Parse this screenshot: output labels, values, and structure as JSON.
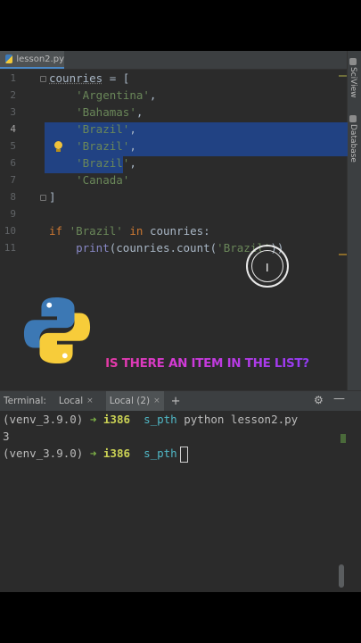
{
  "editor": {
    "tab_label": "lesson2.py",
    "line_numbers": [
      "1",
      "2",
      "3",
      "4",
      "5",
      "6",
      "7",
      "8",
      "9",
      "10",
      "11"
    ],
    "code": {
      "l1_var": "counries",
      "l1_rest": " = [",
      "l2": "'Argentina'",
      "l3": "'Bahamas'",
      "l4": "'Brazil'",
      "l5": "'Brazil'",
      "l6": "'Brazil'",
      "l7": "'Canada'",
      "l8": "]",
      "l10_kw1": "if",
      "l10_str": "'Brazil'",
      "l10_kw2": "in",
      "l10_rest": "counries:",
      "l11_fn": "print",
      "l11_mid": "(counries.count(",
      "l11_str": "'Brazil'",
      "l11_end": "))"
    },
    "comma": ","
  },
  "side_panels": {
    "sciview": "SciView",
    "database": "Database"
  },
  "overlay": {
    "caption": "IS THERE AN ITEM IN THE LIST?"
  },
  "terminal": {
    "title": "Terminal:",
    "tabs": [
      {
        "label": "Local",
        "close": "×"
      },
      {
        "label": "Local (2)",
        "close": "×"
      }
    ],
    "add": "+",
    "lines": [
      {
        "env": "(venv_3.9.0)",
        "arrow": "➜",
        "host": "i386",
        "path": "s_pth",
        "cmd": "python lesson2.py"
      },
      {
        "output": "3"
      },
      {
        "env": "(venv_3.9.0)",
        "arrow": "➜",
        "host": "i386",
        "path": "s_pth",
        "cmd": ""
      }
    ]
  },
  "colors": {
    "selection": "#214283",
    "string": "#6a8759",
    "keyword": "#cc7832"
  }
}
